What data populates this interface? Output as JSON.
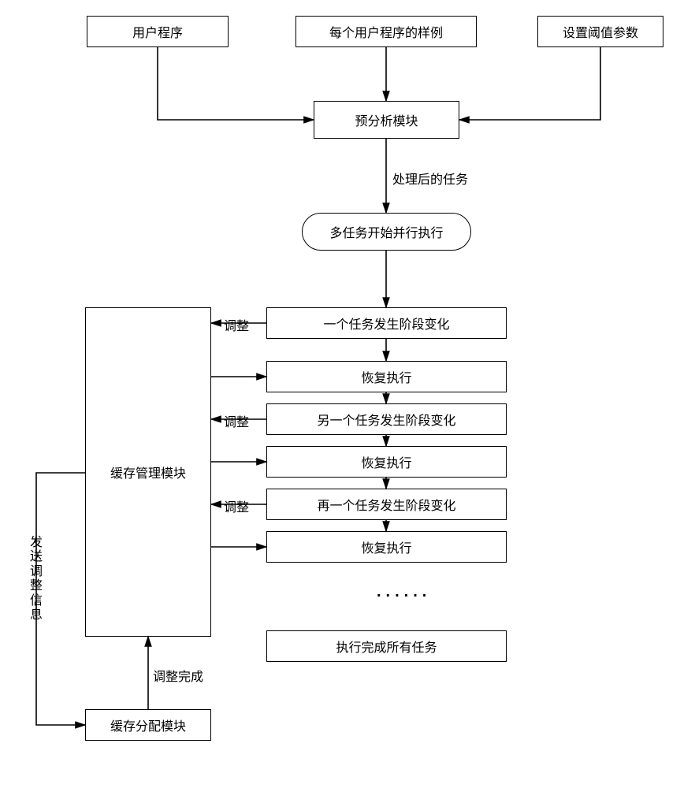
{
  "inputs": {
    "user_program": "用户程序",
    "samples": "每个用户程序的样例",
    "threshold": "设置阈值参数"
  },
  "modules": {
    "pre_analysis": "预分析模块",
    "cache_mgmt": "缓存管理模块",
    "cache_alloc": "缓存分配模块"
  },
  "states": {
    "multi_task_start": "多任务开始并行执行",
    "phase_change_1": "一个任务发生阶段变化",
    "resume_1": "恢复执行",
    "phase_change_2": "另一个任务发生阶段变化",
    "resume_2": "恢复执行",
    "phase_change_3": "再一个任务发生阶段变化",
    "resume_3": "恢复执行",
    "all_done": "执行完成所有任务"
  },
  "labels": {
    "processed_task": "处理后的任务",
    "adjust": "调整",
    "adjust_complete": "调整完成",
    "send_adjust_info": "发送调整信息"
  },
  "dots": "......"
}
